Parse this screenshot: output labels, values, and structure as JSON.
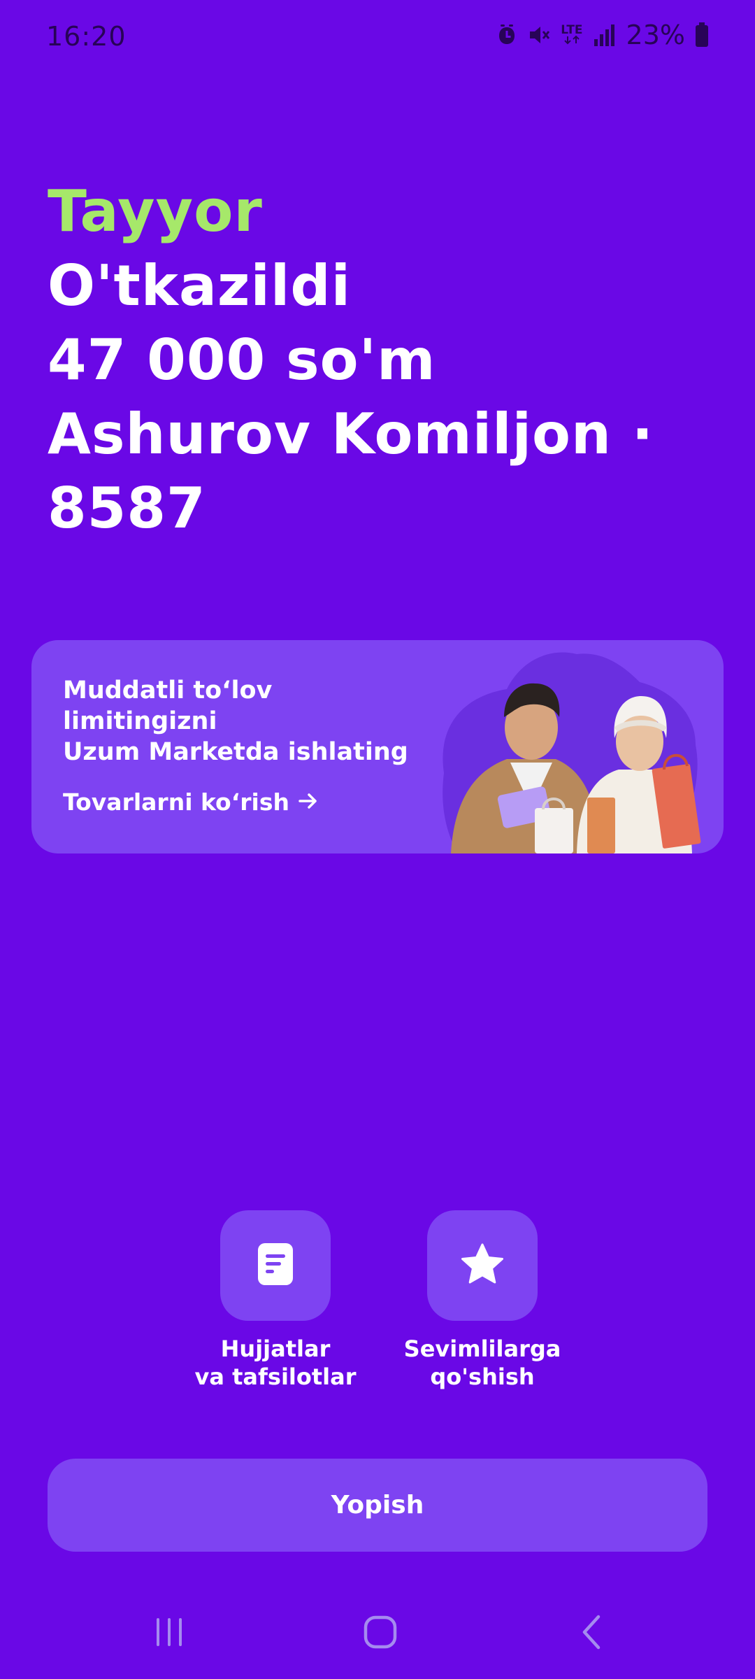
{
  "status_bar": {
    "time": "16:20",
    "battery": "23%",
    "network_label": "LTE",
    "icons": [
      "alarm-icon",
      "mute-icon",
      "lte-icon",
      "signal-icon",
      "battery-icon"
    ]
  },
  "receipt": {
    "status": "Tayyor",
    "title": "O'tkazildi",
    "amount": "47 000 so'm",
    "recipient_line1": "Ashurov Komiljon ·",
    "recipient_line2": "8587"
  },
  "promo": {
    "line1": "Muddatli to‘lov",
    "line2": "limitingizni",
    "line3": "Uzum Marketda ishlating",
    "link_label": "Tovarlarni ko‘rish",
    "link_icon": "arrow-right-icon"
  },
  "actions": [
    {
      "icon": "document-icon",
      "line1": "Hujjatlar",
      "line2": "va tafsilotlar"
    },
    {
      "icon": "star-icon",
      "line1": "Sevimlilarga",
      "line2": "qo'shish"
    }
  ],
  "close_button": {
    "label": "Yopish"
  },
  "nav": {
    "icons": [
      "recent-apps-icon",
      "home-icon",
      "back-icon"
    ]
  },
  "colors": {
    "background": "#6A08E6",
    "surface": "#7E43F2",
    "accent_green": "#A6E86A",
    "text": "#FFFFFF"
  }
}
